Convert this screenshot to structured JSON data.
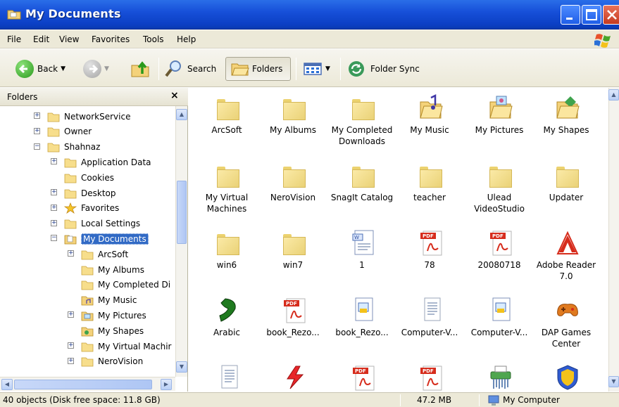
{
  "window": {
    "title": "My Documents"
  },
  "menu": [
    "File",
    "Edit",
    "View",
    "Favorites",
    "Tools",
    "Help"
  ],
  "toolbar": {
    "back": "Back",
    "search": "Search",
    "folders": "Folders",
    "folder_sync": "Folder Sync"
  },
  "folders_pane": {
    "title": "Folders",
    "close": "×",
    "tree": [
      {
        "label": "NetworkService",
        "expander": "+",
        "icon": "folder-icon"
      },
      {
        "label": "Owner",
        "expander": "+",
        "icon": "folder-icon"
      },
      {
        "label": "Shahnaz",
        "expander": "-",
        "icon": "folder-icon"
      },
      {
        "label": "Application Data",
        "expander": "+",
        "icon": "folder-icon"
      },
      {
        "label": "Cookies",
        "expander": "",
        "icon": "folder-icon"
      },
      {
        "label": "Desktop",
        "expander": "+",
        "icon": "folder-icon"
      },
      {
        "label": "Favorites",
        "expander": "+",
        "icon": "star-icon"
      },
      {
        "label": "Local Settings",
        "expander": "+",
        "icon": "folder-icon"
      },
      {
        "label": "My Documents",
        "expander": "-",
        "icon": "documents-folder-icon",
        "selected": true
      },
      {
        "label": "ArcSoft",
        "expander": "+",
        "icon": "folder-icon"
      },
      {
        "label": "My Albums",
        "expander": "",
        "icon": "folder-icon"
      },
      {
        "label": "My Completed Di",
        "expander": "",
        "icon": "folder-icon"
      },
      {
        "label": "My Music",
        "expander": "",
        "icon": "music-folder-icon"
      },
      {
        "label": "My Pictures",
        "expander": "+",
        "icon": "pictures-folder-icon"
      },
      {
        "label": "My Shapes",
        "expander": "",
        "icon": "shapes-folder-icon"
      },
      {
        "label": "My Virtual Machir",
        "expander": "+",
        "icon": "folder-icon"
      },
      {
        "label": "NeroVision",
        "expander": "+",
        "icon": "folder-icon"
      }
    ]
  },
  "items": [
    {
      "label": "ArcSoft",
      "icon": "folder-icon"
    },
    {
      "label": "My Albums",
      "icon": "folder-icon"
    },
    {
      "label": "My Completed Downloads",
      "icon": "folder-icon"
    },
    {
      "label": "My Music",
      "icon": "music-folder-icon"
    },
    {
      "label": "My Pictures",
      "icon": "pictures-folder-icon"
    },
    {
      "label": "My Shapes",
      "icon": "shapes-folder-icon"
    },
    {
      "label": "My Virtual Machines",
      "icon": "folder-icon"
    },
    {
      "label": "NeroVision",
      "icon": "folder-icon"
    },
    {
      "label": "SnagIt Catalog",
      "icon": "folder-icon"
    },
    {
      "label": "teacher",
      "icon": "folder-icon"
    },
    {
      "label": "Ulead VideoStudio",
      "icon": "folder-icon"
    },
    {
      "label": "Updater",
      "icon": "folder-icon"
    },
    {
      "label": "win6",
      "icon": "folder-icon"
    },
    {
      "label": "win7",
      "icon": "folder-icon"
    },
    {
      "label": "1",
      "icon": "word-doc-icon"
    },
    {
      "label": "78",
      "icon": "pdf-icon"
    },
    {
      "label": "20080718",
      "icon": "pdf-icon"
    },
    {
      "label": "Adobe Reader 7.0",
      "icon": "adobe-reader-icon"
    },
    {
      "label": "Arabic",
      "icon": "arabic-app-icon"
    },
    {
      "label": "book_Rezo...",
      "icon": "pdf-icon"
    },
    {
      "label": "book_Rezo...",
      "icon": "snagit-file-icon"
    },
    {
      "label": "Computer-V...",
      "icon": "text-doc-icon"
    },
    {
      "label": "Computer-V...",
      "icon": "snagit-file-icon"
    },
    {
      "label": "DAP Games Center",
      "icon": "gamepad-icon"
    },
    {
      "label": "",
      "icon": "text-doc-icon"
    },
    {
      "label": "",
      "icon": "lightning-app-icon"
    },
    {
      "label": "",
      "icon": "pdf-icon"
    },
    {
      "label": "",
      "icon": "pdf-icon"
    },
    {
      "label": "",
      "icon": "shredder-icon"
    },
    {
      "label": "",
      "icon": "shield-app-icon"
    }
  ],
  "status": {
    "objects": "40 objects (Disk free space: 11.8 GB)",
    "size": "47.2 MB",
    "location": "My Computer"
  },
  "colors": {
    "titlebar": "#1750d9",
    "chrome": "#ece9d8",
    "selection": "#316ac5",
    "pdf_red": "#d62c1c"
  }
}
